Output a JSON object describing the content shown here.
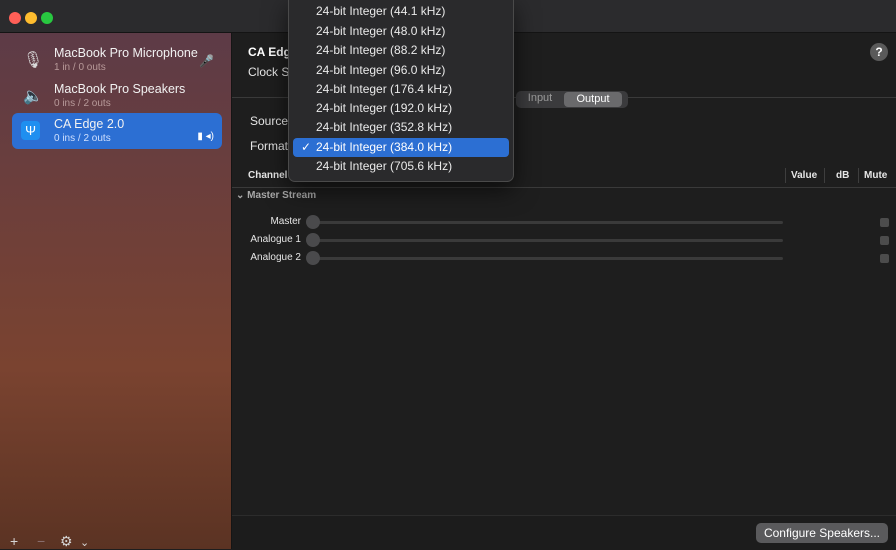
{
  "sidebar": {
    "devices": [
      {
        "name": "MacBook Pro Microphone",
        "io": "1 in / 0 outs",
        "icon": "microphone-icon"
      },
      {
        "name": "MacBook Pro Speakers",
        "io": "0 ins / 2 outs",
        "icon": "speaker-icon"
      },
      {
        "name": "CA Edge 2.0",
        "io": "0 ins / 2 outs",
        "icon": "usb-icon"
      }
    ],
    "add": "+",
    "remove": "−",
    "gear": "⚙",
    "chevron": "⌄"
  },
  "main": {
    "device_name": "CA Edg",
    "clock_label": "Clock S",
    "help": "?",
    "tabs": {
      "input": "Input",
      "output": "Output"
    },
    "source_label": "Source",
    "format_label": "Format",
    "columns": {
      "channel": "Channel",
      "value": "Value",
      "db": "dB",
      "mute": "Mute"
    },
    "stream": "Master Stream",
    "channels": [
      "Master",
      "Analogue 1",
      "Analogue 2"
    ],
    "configure": "Configure Speakers..."
  },
  "format_menu": {
    "items": [
      "24-bit Integer (44.1 kHz)",
      "24-bit Integer (48.0 kHz)",
      "24-bit Integer (88.2 kHz)",
      "24-bit Integer (96.0 kHz)",
      "24-bit Integer (176.4 kHz)",
      "24-bit Integer (192.0 kHz)",
      "24-bit Integer (352.8 kHz)",
      "24-bit Integer (384.0 kHz)",
      "24-bit Integer (705.6 kHz)"
    ],
    "selected": "24-bit Integer (384.0 kHz)",
    "check": "✓"
  }
}
